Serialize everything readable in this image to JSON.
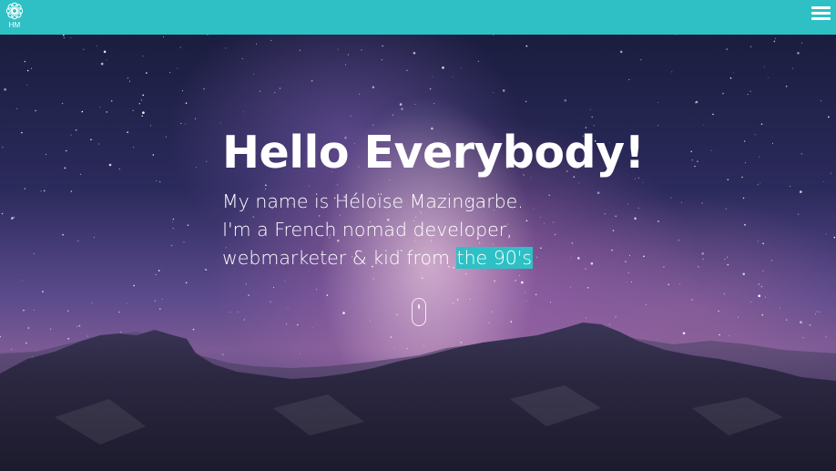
{
  "header": {
    "logo_text": "HM",
    "background": "#2ec0c4",
    "menu_icon": "hamburger-menu-icon"
  },
  "hero": {
    "headline": "Hello Everybody!",
    "intro_line1": "My name is Héloïse Mazingarbe.",
    "intro_line2": "I'm a French nomad developer,",
    "intro_line3_prefix": "webmarketer & kid from ",
    "intro_highlight": "the 90's",
    "accent_color": "#2ec0c4",
    "scroll_icon": "mouse-scroll-icon"
  }
}
